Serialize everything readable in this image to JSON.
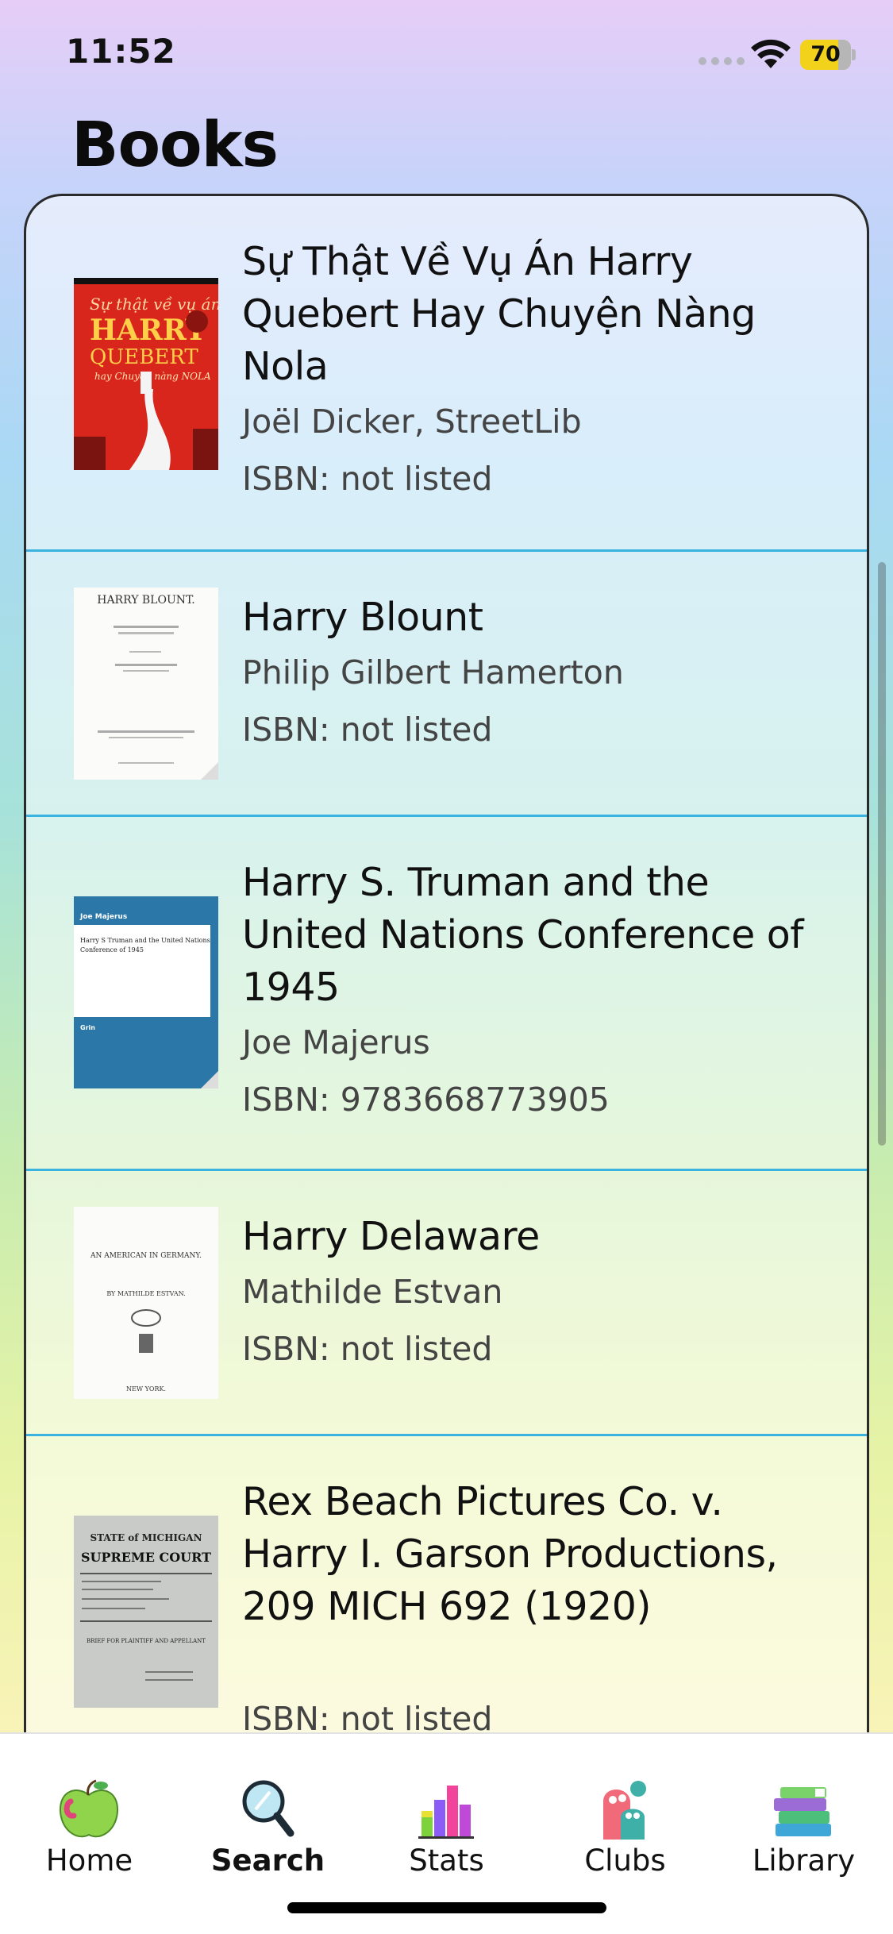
{
  "status_bar": {
    "time": "11:52",
    "battery": "70"
  },
  "page_title": "Books",
  "books": [
    {
      "title": "Sự Thật Về Vụ Án Harry Quebert Hay Chuyện Nàng Nola",
      "author": "Joël Dicker, StreetLib",
      "isbn": "ISBN: not listed",
      "cover": {
        "line1": "Sự thật về vụ án",
        "line2": "HARRY",
        "line3": "QUEBERT",
        "line4": "hay Chuyện nàng NOLA"
      }
    },
    {
      "title": "Harry Blount",
      "author": "Philip Gilbert Hamerton",
      "isbn": "ISBN: not listed",
      "cover": {
        "line1": "HARRY BLOUNT."
      }
    },
    {
      "title": "Harry S. Truman and the United Nations Conference of 1945",
      "author": "Joe Majerus",
      "isbn": "ISBN: 9783668773905",
      "cover": {
        "line1": "Joe Majerus",
        "line2": "Harry S Truman and the United Nations Conference of 1945",
        "line3": "Grin"
      }
    },
    {
      "title": "Harry Delaware",
      "author": "Mathilde Estvan",
      "isbn": "ISBN: not listed",
      "cover": {
        "line1": "AN AMERICAN IN GERMANY.",
        "line2": "BY MATHILDE ESTVAN.",
        "line3": "NEW YORK."
      }
    },
    {
      "title": "Rex Beach Pictures Co. v. Harry I. Garson Productions, 209 MICH 692 (1920)",
      "author": "",
      "isbn": "ISBN: not listed",
      "cover": {
        "line1": "STATE of MICHIGAN",
        "line2": "SUPREME COURT",
        "line3": "BRIEF FOR PLAINTIFF AND APPELLANT"
      }
    }
  ],
  "tabs": [
    {
      "label": "Home",
      "icon": "apple-icon"
    },
    {
      "label": "Search",
      "icon": "magnifier-icon",
      "active": true
    },
    {
      "label": "Stats",
      "icon": "bar-chart-icon"
    },
    {
      "label": "Clubs",
      "icon": "creatures-icon"
    },
    {
      "label": "Library",
      "icon": "book-stack-icon"
    }
  ],
  "colors": {
    "row_divider": "#3bb3e0",
    "battery_fill": "#f2d21b",
    "cover_red": "#d9261c",
    "cover_blue": "#2b78a8"
  }
}
